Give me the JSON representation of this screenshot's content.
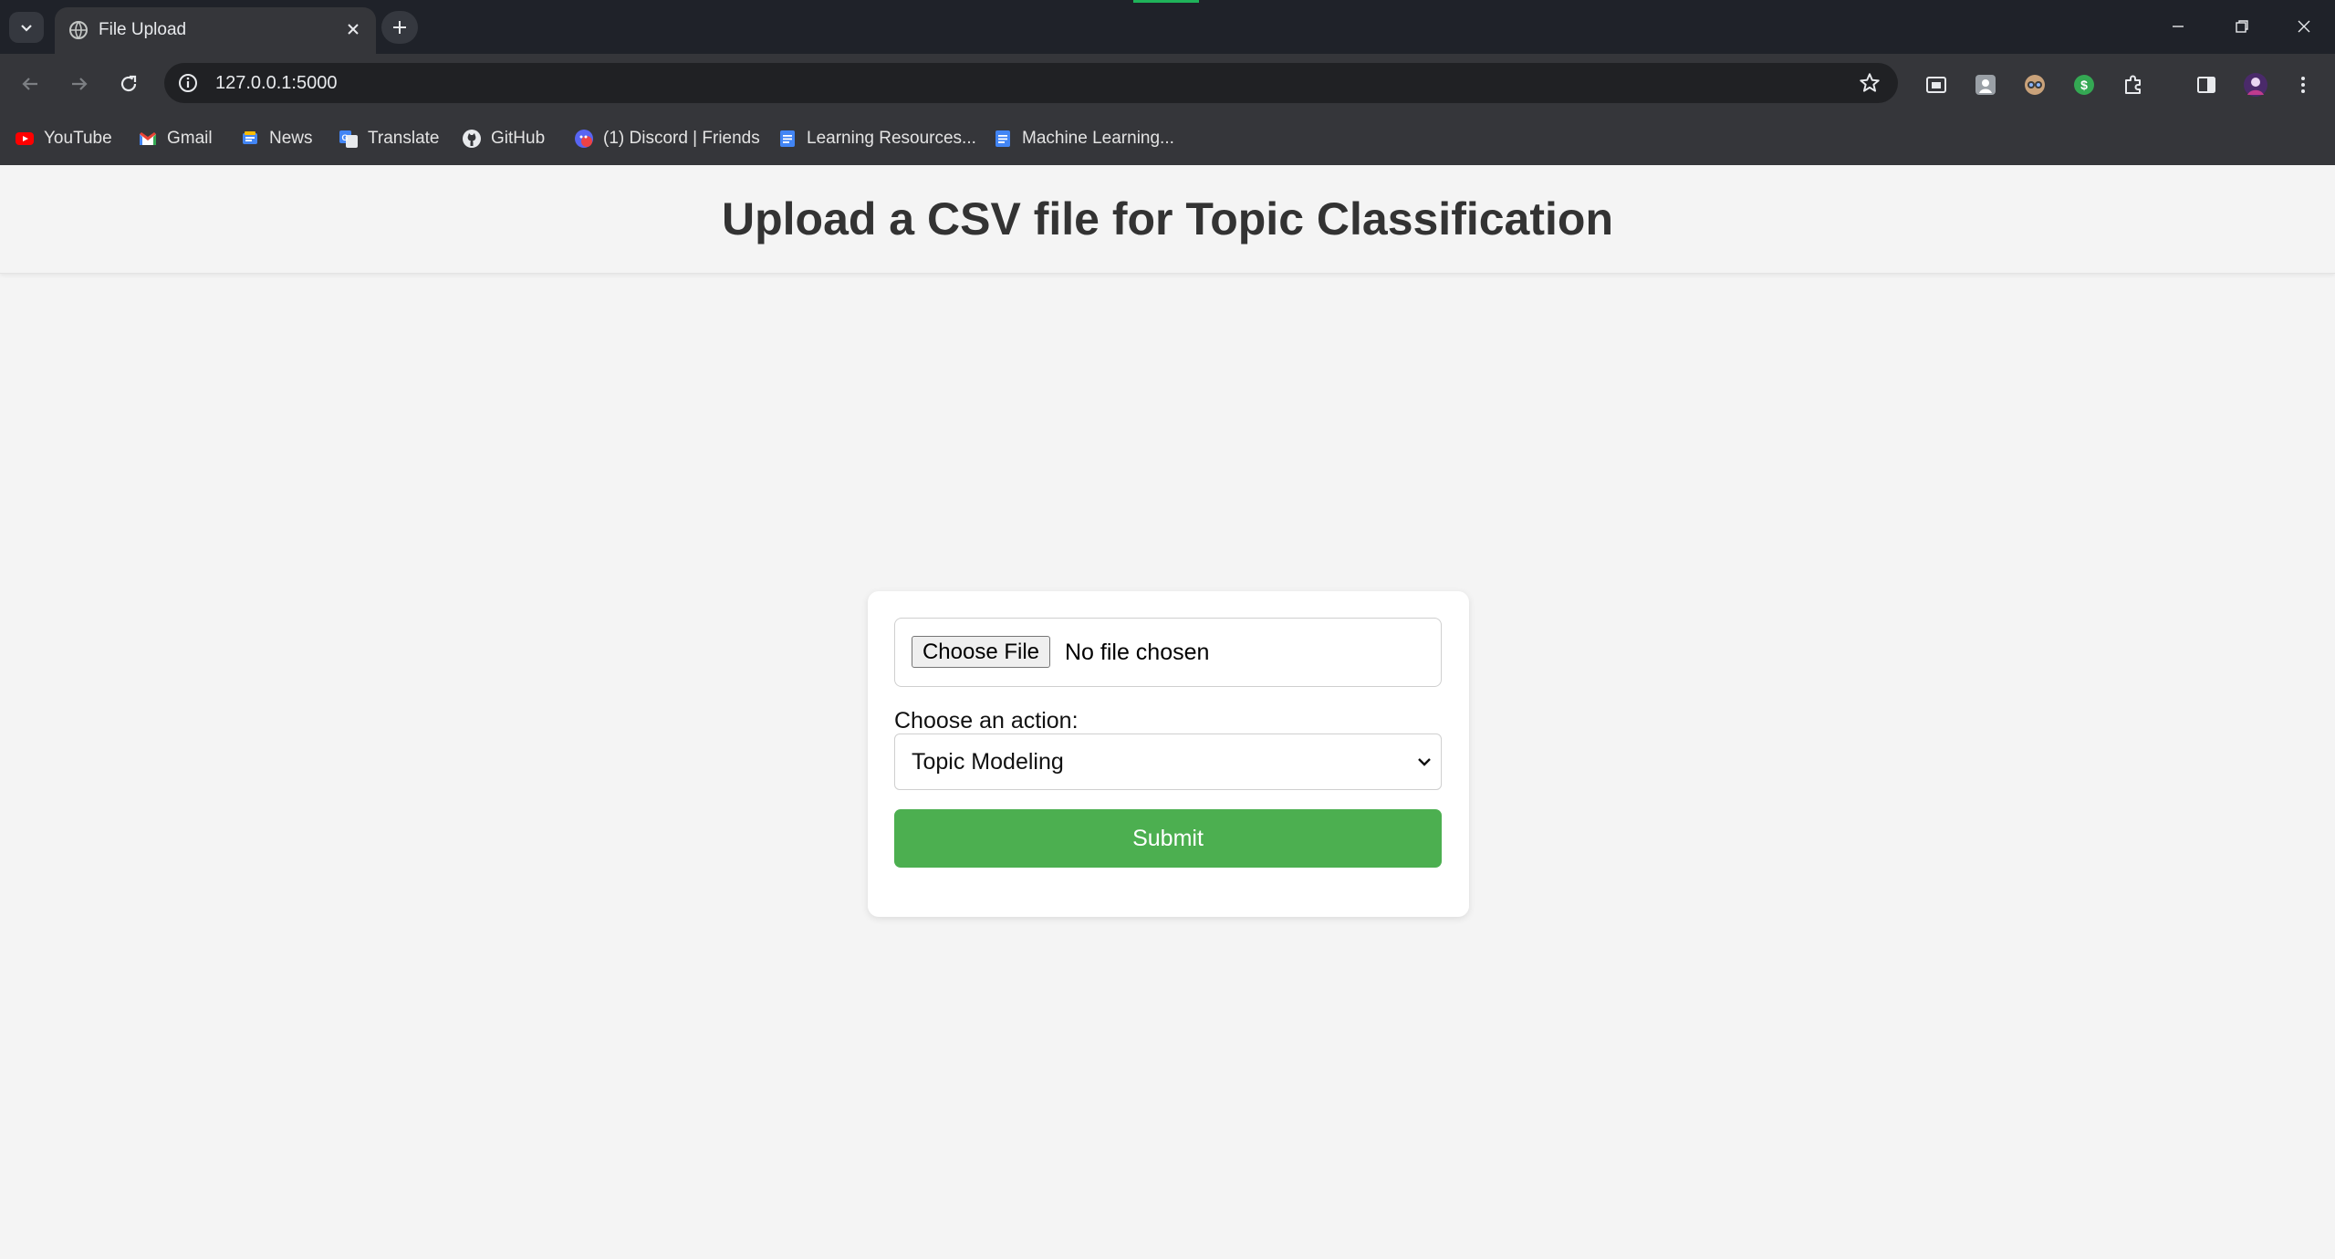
{
  "browser": {
    "tab_title": "File Upload",
    "url": "127.0.0.1:5000",
    "bookmarks": [
      {
        "label": "YouTube",
        "icon": "youtube-icon"
      },
      {
        "label": "Gmail",
        "icon": "gmail-icon"
      },
      {
        "label": "News",
        "icon": "news-icon"
      },
      {
        "label": "Translate",
        "icon": "translate-icon"
      },
      {
        "label": "GitHub",
        "icon": "github-icon"
      },
      {
        "label": "(1) Discord | Friends",
        "icon": "discord-icon"
      },
      {
        "label": "Learning Resources...",
        "icon": "docs-icon"
      },
      {
        "label": "Machine Learning...",
        "icon": "docs-icon"
      }
    ]
  },
  "page": {
    "title": "Upload a CSV file for Topic Classification",
    "file_input": {
      "button_label": "Choose File",
      "status": "No file chosen"
    },
    "action_label": "Choose an action:",
    "action_select_value": "Topic Modeling",
    "submit_label": "Submit"
  },
  "colors": {
    "submit_green": "#4caf50",
    "page_background": "#f4f4f4",
    "chrome_dark": "#35363a"
  }
}
